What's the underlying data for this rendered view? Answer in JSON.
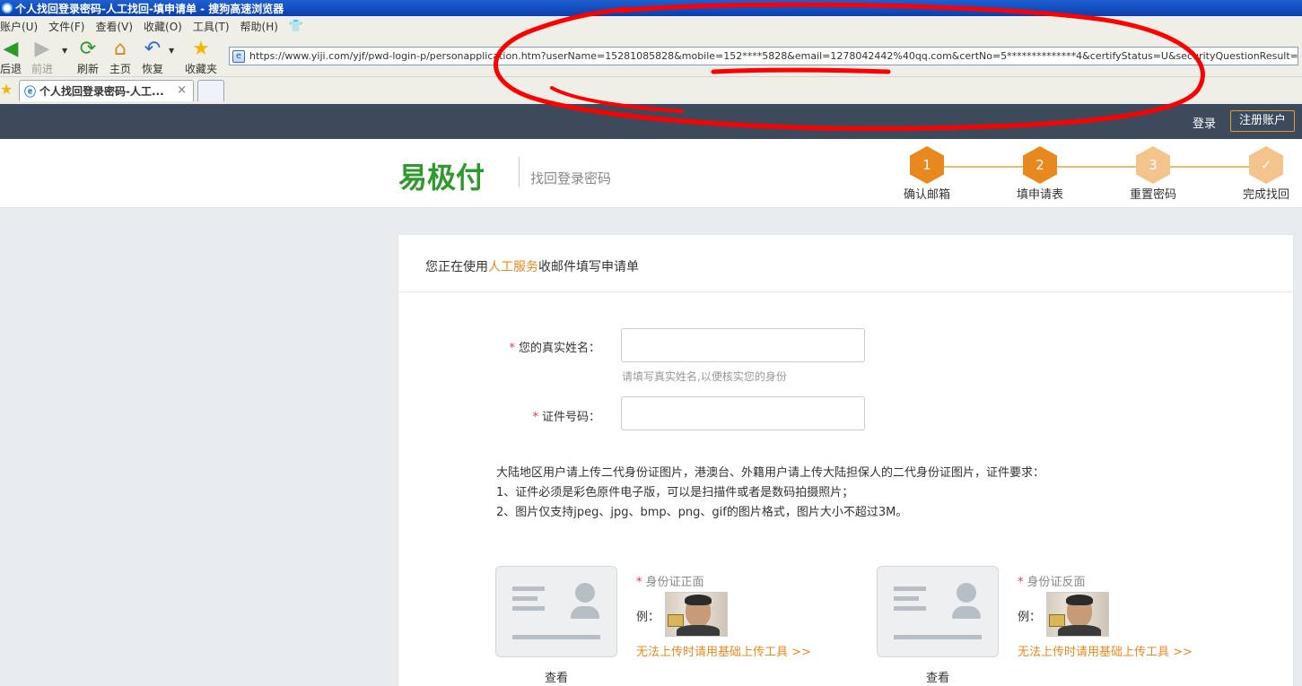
{
  "window": {
    "title": "个人找回登录密码-人工找回-填申请单 - 搜狗高速浏览器"
  },
  "menubar": {
    "items": [
      "账户(U)",
      "文件(F)",
      "查看(V)",
      "收藏(O)",
      "工具(T)",
      "帮助(H)"
    ]
  },
  "toolbar": {
    "back": "后退",
    "forward": "前进",
    "refresh": "刷新",
    "home": "主页",
    "restore": "恢复",
    "favorites": "收藏夹"
  },
  "address_bar": {
    "url": "https://www.yiji.com/yjf/pwd-login-p/personapplication.htm?userName=15281085828&mobile=152****5828&email=1278042442%40qq.com&certNo=5**************4&certifyStatus=U&securityQuestionResult=tru"
  },
  "tabs": [
    {
      "label": "个人找回登录密码-人工...",
      "close": "×"
    }
  ],
  "site": {
    "login": "登录",
    "register": "注册账户",
    "logo": "易极付",
    "subtitle": "找回登录密码",
    "steps": [
      {
        "num": "1",
        "label": "确认邮箱"
      },
      {
        "num": "2",
        "label": "填申请表"
      },
      {
        "num": "3",
        "label": "重置密码"
      },
      {
        "num": "✓",
        "label": "完成找回"
      }
    ]
  },
  "form": {
    "heading_pre": "您正在使用",
    "heading_highlight": "人工服务",
    "heading_post": "收邮件填写申请单",
    "required_mark": "*",
    "name_label": "您的真实姓名：",
    "name_value": "",
    "name_hint": "请填写真实姓名,以便核实您的身份",
    "cert_label": "证件号码：",
    "cert_value": "",
    "notes": [
      "大陆地区用户请上传二代身份证图片，港澳台、外籍用户请上传大陆担保人的二代身份证图片，证件要求：",
      "1、证件必须是彩色原件电子版，可以是扫描件或者是数码拍摄照片；",
      "2、图片仅支持jpeg、jpg、bmp、png、gif的图片格式，图片大小不超过3M。"
    ],
    "uploads": [
      {
        "title": "身份证正面",
        "example": "例：",
        "link": "无法上传时请用基础上传工具 >>",
        "view": "查看"
      },
      {
        "title": "身份证反面",
        "example": "例：",
        "link": "无法上传时请用基础上传工具 >>",
        "view": "查看"
      }
    ]
  },
  "colors": {
    "accent": "#e8891f",
    "logo_green": "#2f9a2c",
    "topbar": "#3c4a5c",
    "annotation_red": "#ff0000"
  }
}
